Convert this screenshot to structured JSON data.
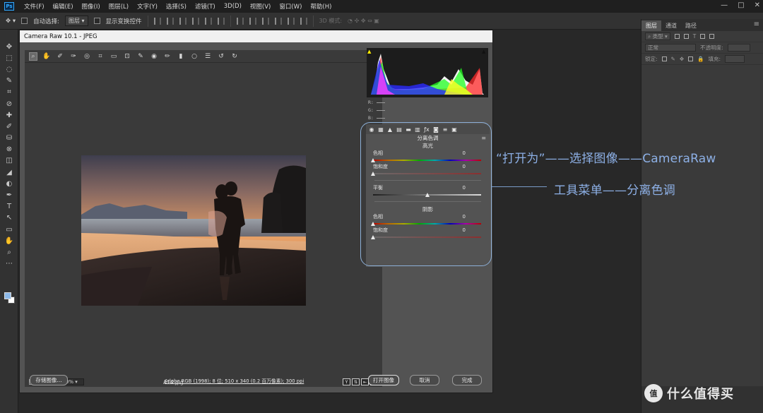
{
  "menubar": {
    "logo": "Ps",
    "items": [
      "文件(F)",
      "编辑(E)",
      "图像(I)",
      "图层(L)",
      "文字(Y)",
      "选择(S)",
      "滤镜(T)",
      "3D(D)",
      "视图(V)",
      "窗口(W)",
      "帮助(H)"
    ],
    "window_controls": [
      "—",
      "□",
      "✕"
    ]
  },
  "optbar": {
    "auto_select_label": "自动选择:",
    "auto_select_value": "图层",
    "show_transform_label": "显示变换控件",
    "mode_3d_label": "3D 模式:"
  },
  "toolbar": {
    "tools": [
      "✥",
      "⬚",
      "◌",
      "✎",
      "⌗",
      "⊘",
      "✚",
      "✐",
      "⛁",
      "⊗",
      "◫",
      "◢",
      "◐",
      "✒",
      "T",
      "↖",
      "▭",
      "✋",
      "⌕",
      "⋯"
    ]
  },
  "right_panel": {
    "tabs": [
      "图层",
      "通道",
      "路径"
    ],
    "kind_placeholder": "类型",
    "blend_mode": "正常",
    "opacity_label": "不透明度:",
    "lock_label": "锁定:",
    "fill_label": "填充:"
  },
  "camera_raw": {
    "title": "Camera Raw 10.1 -  JPEG",
    "zoom": "100%",
    "filename": "A14.jpg",
    "rgb_labels": [
      "R:",
      "G:",
      "B:"
    ],
    "panel_title": "分离色调",
    "highlights": {
      "label": "高光",
      "hue_label": "色相",
      "hue_value": "0",
      "saturation_label": "饱和度",
      "saturation_value": "0"
    },
    "balance": {
      "label": "平衡",
      "value": "0"
    },
    "shadows": {
      "label": "阴影",
      "hue_label": "色相",
      "hue_value": "0",
      "saturation_label": "饱和度",
      "saturation_value": "0"
    },
    "save_button": "存储图像...",
    "workflow_text": "Adobe RGB (1998); 8 位; 510 x 340 (0.2 百万像素); 300 ppi",
    "open_button": "打开图像",
    "cancel_button": "取消",
    "done_button": "完成"
  },
  "annotations": {
    "line1": "“打开为”——选择图像——CameraRaw",
    "line2": "工具菜单——分离色调"
  },
  "watermark": {
    "logo": "值",
    "text": "什么值得买"
  },
  "colors": {
    "annotation": "#8db0e6",
    "ps_blue": "#31a8ff",
    "dialog_bg": "#535353"
  }
}
